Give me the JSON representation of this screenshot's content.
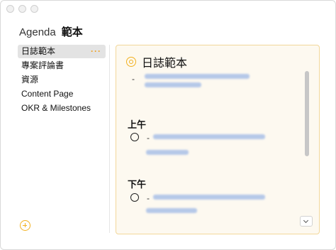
{
  "window": {
    "title_prefix": "Agenda",
    "title_main": "範本"
  },
  "sidebar": {
    "items": [
      {
        "label": "日誌範本",
        "active": true,
        "more": "···"
      },
      {
        "label": "專案評論書"
      },
      {
        "label": "資源"
      },
      {
        "label": "Content Page"
      },
      {
        "label": "OKR & Milestones"
      }
    ]
  },
  "panel": {
    "title": "日誌範本",
    "dash": "-",
    "sections": [
      {
        "label": "上午"
      },
      {
        "label": "下午"
      }
    ]
  },
  "colors": {
    "accent": "#f2b01e",
    "panel_bg": "#fdf9f0",
    "panel_border": "#f2d79a",
    "selection": "#e3e3e3",
    "blurred_link": "#9eb8e6"
  },
  "icons": {
    "add": "plus-circle-icon",
    "panel_title": "target-icon",
    "task": "circle-icon",
    "more": "ellipsis-icon",
    "dropdown": "chevron-down-icon"
  }
}
